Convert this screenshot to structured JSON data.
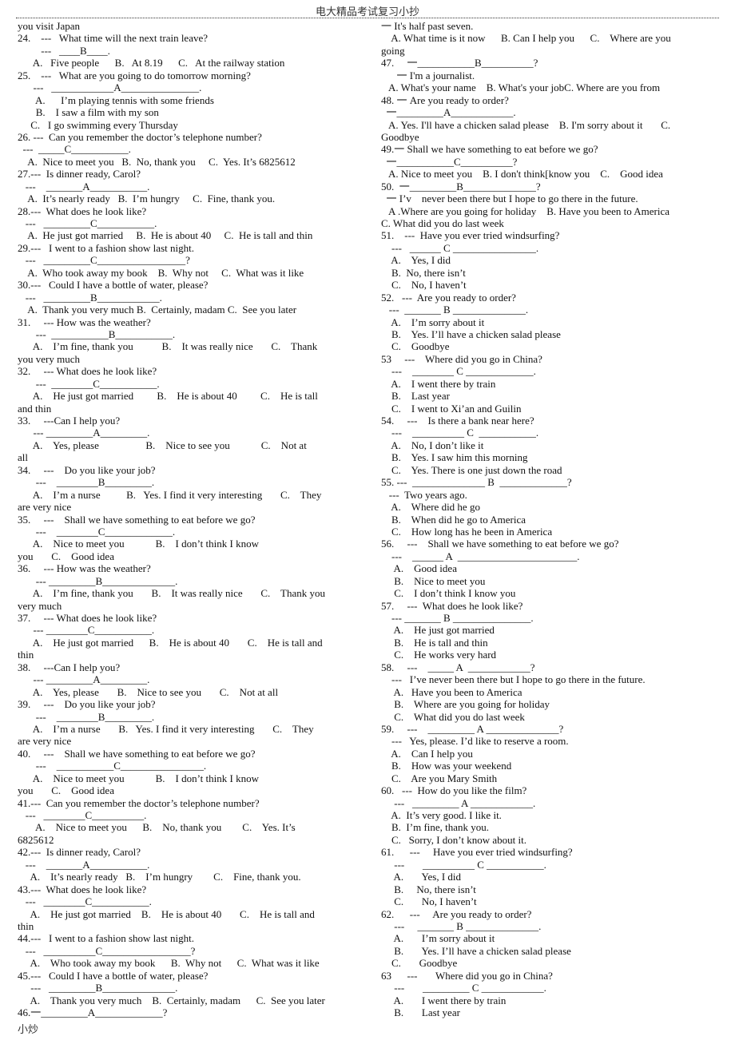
{
  "header": {
    "title": "电大精品考试复习小抄"
  },
  "footer": {
    "text": "小炒"
  },
  "left_column": [
    "you visit Japan",
    "24.    ---   What time will the next train leave?",
    "         ---   ____B____.",
    "      A.   Five people      B.   At 8.19      C.   At the railway station",
    "25.    ---   What are you going to do tomorrow morning?",
    "      ---   ____________A_______________.",
    "       A.      I’m playing tennis with some friends",
    "       B.    I saw a film with my son",
    "     C.   I go swimming every Thursday",
    "26. ---  Can you remember the doctor’s telephone number?",
    "  ---  _____C___________.",
    "    A.  Nice to meet you   B.  No, thank you     C.  Yes. It’s 6825612",
    "27.---  Is dinner ready, Carol?",
    "   ---    _______A___________.",
    "    A.  It’s nearly ready   B.  I’m hungry     C.  Fine, thank you.",
    "28.---  What does he look like?",
    "   ---   _________C___________.",
    "    A.  He just got married     B.  He is about 40     C.  He is tall and thin",
    "29.---   I went to a fashion show last night.",
    "   ---   _________C_________________?",
    "    A.  Who took away my book    B.  Why not     C.  What was it like",
    "30.---   Could I have a bottle of water, please?",
    "   ---   _________B____________.",
    "    A.  Thank you very much B.  Certainly, madam C.  See you later",
    "31.     --- How was the weather?",
    "       ---  ___________B___________.",
    "      A.    I’m fine, thank you           B.    It was really nice       C.    Thank",
    "you very much",
    "32.     --- What does he look like?",
    "       ---  ________C___________.",
    "      A.    He just got married         B.    He is about 40         C.    He is tall",
    "and thin",
    "33.     ---Can I help you?",
    "      --- _________A_________.",
    "      A.    Yes, please                  B.    Nice to see you            C.    Not at",
    "all",
    "34.     ---    Do you like your job?",
    "       ---    ________B_________.",
    "      A.    I’m a nurse          B.   Yes. I find it very interesting       C.    They",
    "are very nice",
    "35.     ---    Shall we have something to eat before we go?",
    "       ---    ________C_____________.",
    "      A.    Nice to meet you            B.    I don’t think I know",
    "you       C.    Good idea",
    "36.     --- How was the weather?",
    "       --- _________B______________.",
    "      A.    I’m fine, thank you       B.    It was really nice       C.    Thank you",
    "very much",
    "37.     --- What does he look like?",
    "      --- ________C___________.",
    "      A.    He just got married      B.    He is about 40       C.    He is tall and",
    "thin",
    "38.     ---Can I help you?",
    "      --- _________A_________.",
    "      A.    Yes, please       B.    Nice to see you       C.    Not at all",
    "39.     ---    Do you like your job?",
    "       ---    ________B_________.",
    "      A.    I’m a nurse       B.   Yes. I find it very interesting       C.    They",
    "are very nice",
    "40.     ---    Shall we have something to eat before we go?",
    "       ---    ___________C________________.",
    "      A.    Nice to meet you            B.    I don’t think I know",
    "you       C.    Good idea",
    "41.---  Can you remember the doctor’s telephone number?",
    "   ---   ________C__________.",
    "       A.    Nice to meet you      B.    No, thank you        C.    Yes. It’s",
    "6825612",
    "42.---  Is dinner ready, Carol?",
    "   ---    _______A___________.",
    "     A.    It’s nearly ready   B.    I’m hungry        C.    Fine, thank you.",
    "43.---  What does he look like?",
    "   ---   ________C___________.",
    "     A.    He just got married    B.    He is about 40       C.    He is tall and",
    "thin",
    "44.---   I went to a fashion show last night.",
    "   ---   __________C_________________?",
    "     A.    Who took away my book      B.  Why not      C.  What was it like",
    "45.---   Could I have a bottle of water, please?",
    "     ---   _________B______________.",
    "     A.    Thank you very much    B.  Certainly, madam      C.  See you later",
    "46.一_________A_____________?"
  ],
  "right_column": [
    "一 It's half past seven.",
    "    A. What time is it now      B. Can I help you      C.    Where are you",
    "going",
    "47.     一___________B__________?",
    "      一 I'm a journalist.",
    "   A. What's your name    B. What's your jobC. Where are you from",
    "48. 一 Are you ready to order?",
    "  一_________A____________.",
    "   A. Yes. I'll have a chicken salad please    B. I'm sorry about it       C.",
    "Goodbye",
    "49.一 Shall we have something to eat before we go?",
    "  一___________C__________?",
    "   A. Nice to meet you    B. I don't think[know you    C.    Good idea",
    "50.  一_________B______________?",
    "  一 I’v    never been there but I hope to go there in the future.",
    "   A .Where are you going for holiday    B. Have you been to America",
    "C. What did you do last week",
    "51.    ---  Have you ever tried windsurfing?",
    "    ---   ______ C ________________.",
    "    A.    Yes, I did",
    "    B.  No, there isn’t",
    "    C.    No, I haven’t",
    "52.   ---  Are you ready to order?",
    "   ---  _______ B ______________.",
    "    A.    I’m sorry about it",
    "    B.    Yes. I’ll have a chicken salad please",
    "    C.    Goodbye",
    "53     ---    Where did you go in China?",
    "    ---    ________ C _____________.",
    "    A.    I went there by train",
    "    B.    Last year",
    "    C.    I went to Xi’an and Guilin",
    "54.     ---    Is there a bank near here?",
    "    ---    __________ C  ___________.",
    "    A.    No, I don’t like it",
    "    B.    Yes. I saw him this morning",
    "    C.    Yes. There is one just down the road",
    "55. ---  ______________ B  _____________?",
    "   ---  Two years ago.",
    "    A.    Where did he go",
    "    B.    When did he go to America",
    "    C.    How long has he been in America",
    "56.     ---    Shall we have something to eat before we go?",
    "    ---    ______ A  _______________________.",
    "     A.    Good idea",
    "     B.    Nice to meet you",
    "     C.    I don’t think I know you",
    "57.     ---  What does he look like?",
    "    --- _______ B _______________.",
    "     A.    He just got married",
    "     B.    He is tall and thin",
    "     C.    He works very hard",
    "58.     ---    _____ A  ____________?",
    "    ---   I’ve never been there but I hope to go there in the future.",
    "     A.   Have you been to America",
    "     B.    Where are you going for holiday",
    "     C.    What did you do last week",
    "59.     ---    _________ A ______________?",
    "    ---   Yes, please. I’d like to reserve a room.",
    "    A.    Can I help you",
    "    B.    How was your weekend",
    "    C.    Are you Mary Smith",
    "60.   ---  How do you like the film?",
    "     ---   _________ A ____________.",
    "    A.  It’s very good. I like it.",
    "    B.  I’m fine, thank you.",
    "    C.   Sorry, I don’t know about it.",
    "61.      ---     Have you ever tried windsurfing?",
    "     ---       __________ C ___________.",
    "     A.       Yes, I did",
    "     B.     No, there isn’t",
    "     C.       No, I haven’t",
    "62.      ---     Are you ready to order?",
    "     ---     _______ B ______________.",
    "     A.       I’m sorry about it",
    "     B.       Yes. I’ll have a chicken salad please",
    "    C.       Goodbye",
    "63      ---       Where did you go in China?",
    "     ---       _________ C ____________.",
    "     A.       I went there by train",
    "     B.       Last year"
  ]
}
